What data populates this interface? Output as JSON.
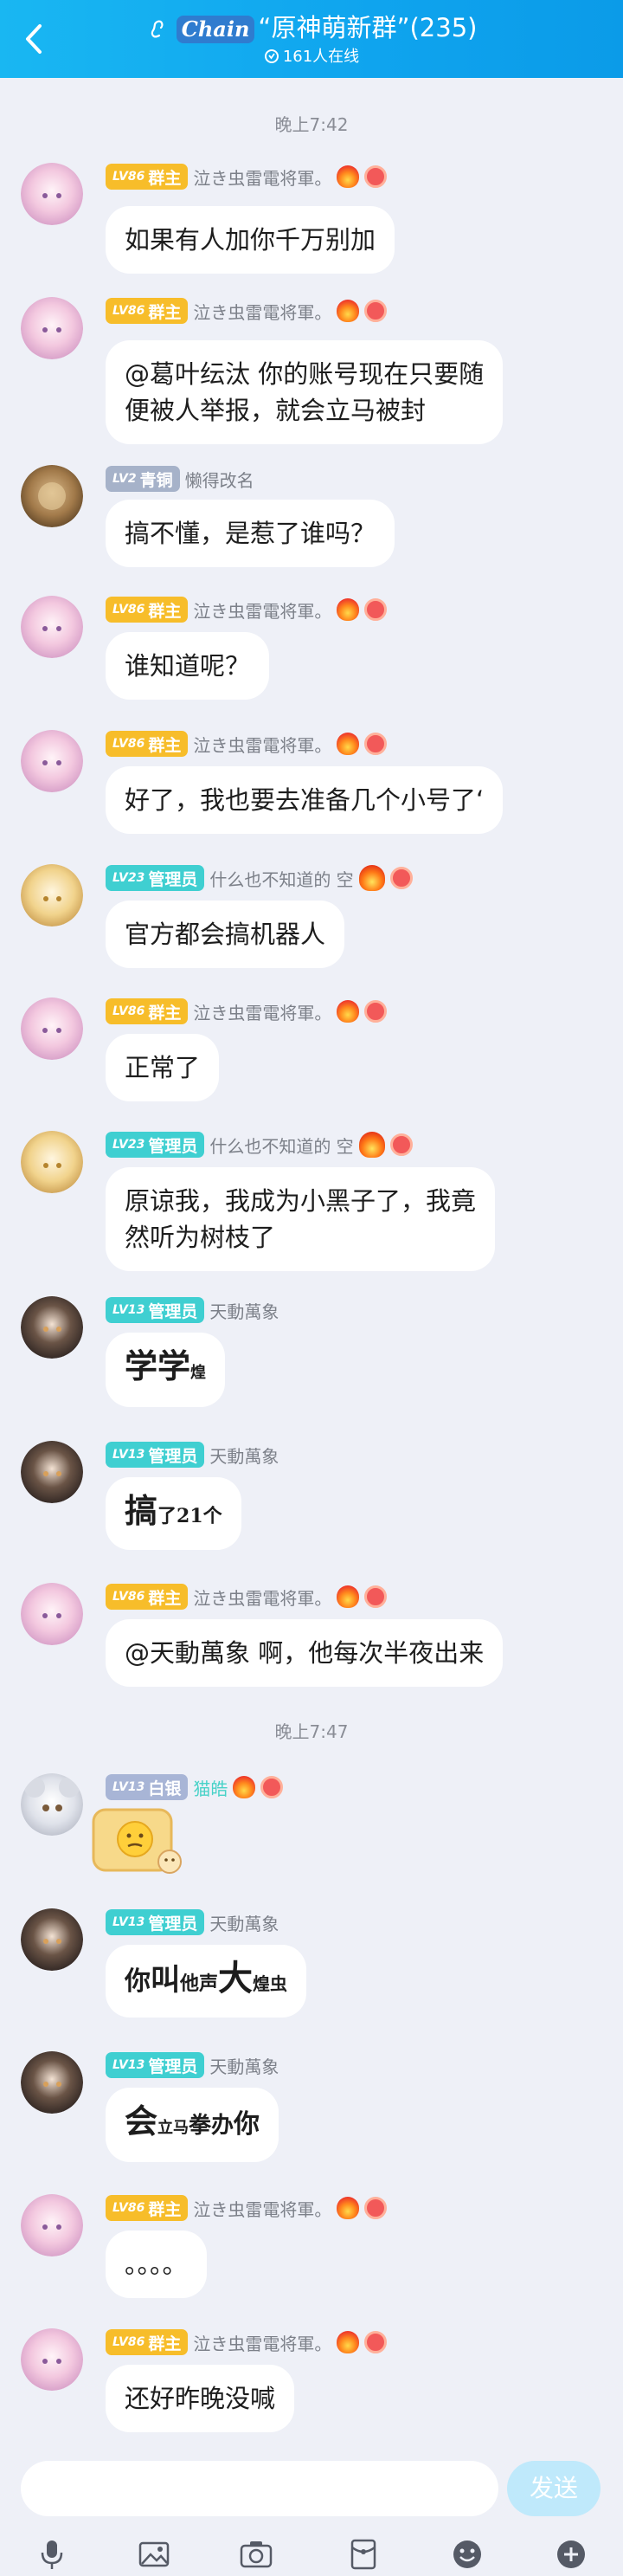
{
  "header": {
    "title_prefix": "“原神萌新群”",
    "member_count": "(235)",
    "online": "161人在线",
    "logo": "Chain"
  },
  "times": [
    "晚上7:42",
    "晚上7:47"
  ],
  "users": {
    "owner": {
      "level": "LV86",
      "role": "群主",
      "name": "泣き虫雷電将軍。"
    },
    "bronze": {
      "level": "LV2",
      "role": "青铜",
      "name": "懒得改名"
    },
    "admin_sora": {
      "level": "LV23",
      "role": "管理员",
      "name": "什么也不知道的 空"
    },
    "admin_tian": {
      "level": "LV13",
      "role": "管理员",
      "name": "天動萬象"
    },
    "silver": {
      "level": "LV13",
      "role": "白银",
      "name": "猫皓"
    }
  },
  "messages": [
    {
      "text": "如果有人加你千万别加"
    },
    {
      "line1": "@葛叶纭汰 你的账号现在只要随",
      "line2": "便被人举报，就会立马被封"
    },
    {
      "text": "搞不懂，是惹了谁吗？"
    },
    {
      "text": "谁知道呢？"
    },
    {
      "text": "好了，我也要去准备几个小号了‘"
    },
    {
      "text": "官方都会搞机器人"
    },
    {
      "text": "正常了"
    },
    {
      "line1": "原谅我，我成为小黑子了，我竟",
      "line2": "然听为树枝了"
    },
    {
      "big": "学学",
      "small": "煌"
    },
    {
      "big": "搞",
      "small": "了21个"
    },
    {
      "text": "@天動萬象 啊，他每次半夜出来"
    },
    {
      "sticker": "emoji-sticker"
    },
    {
      "a": "你",
      "b": "叫",
      "c": "他声",
      "d": "大",
      "e": "煌虫"
    },
    {
      "a": "会",
      "b": "立马",
      "c": "拳办",
      "d": "你"
    },
    {
      "text": "。。。。"
    },
    {
      "text": "还好昨晚没喊"
    }
  ],
  "input": {
    "send_label": "发送",
    "placeholder": ""
  },
  "toolbar": [
    "mic-icon",
    "image-icon",
    "camera-icon",
    "red-packet-icon",
    "emoji-icon",
    "plus-icon"
  ]
}
